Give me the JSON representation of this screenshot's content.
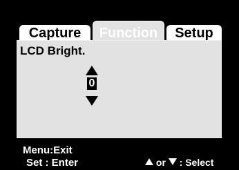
{
  "tabs": [
    {
      "label": "Capture",
      "active": true
    },
    {
      "label": "Function",
      "active": false
    },
    {
      "label": "Setup",
      "active": true
    }
  ],
  "setting": {
    "label": "LCD Bright.",
    "value": "0"
  },
  "footer": {
    "exit_hint": "Menu:Exit",
    "enter_hint": "Set : Enter",
    "or_text": "or",
    "select_text": ": Select"
  },
  "icons": {
    "stepper_up": "triangle-up-icon",
    "stepper_down": "triangle-down-icon"
  },
  "colors": {
    "background": "#000000",
    "panel": "#e2e2e2",
    "active_tab": "#ffffff",
    "text": "#000000"
  }
}
